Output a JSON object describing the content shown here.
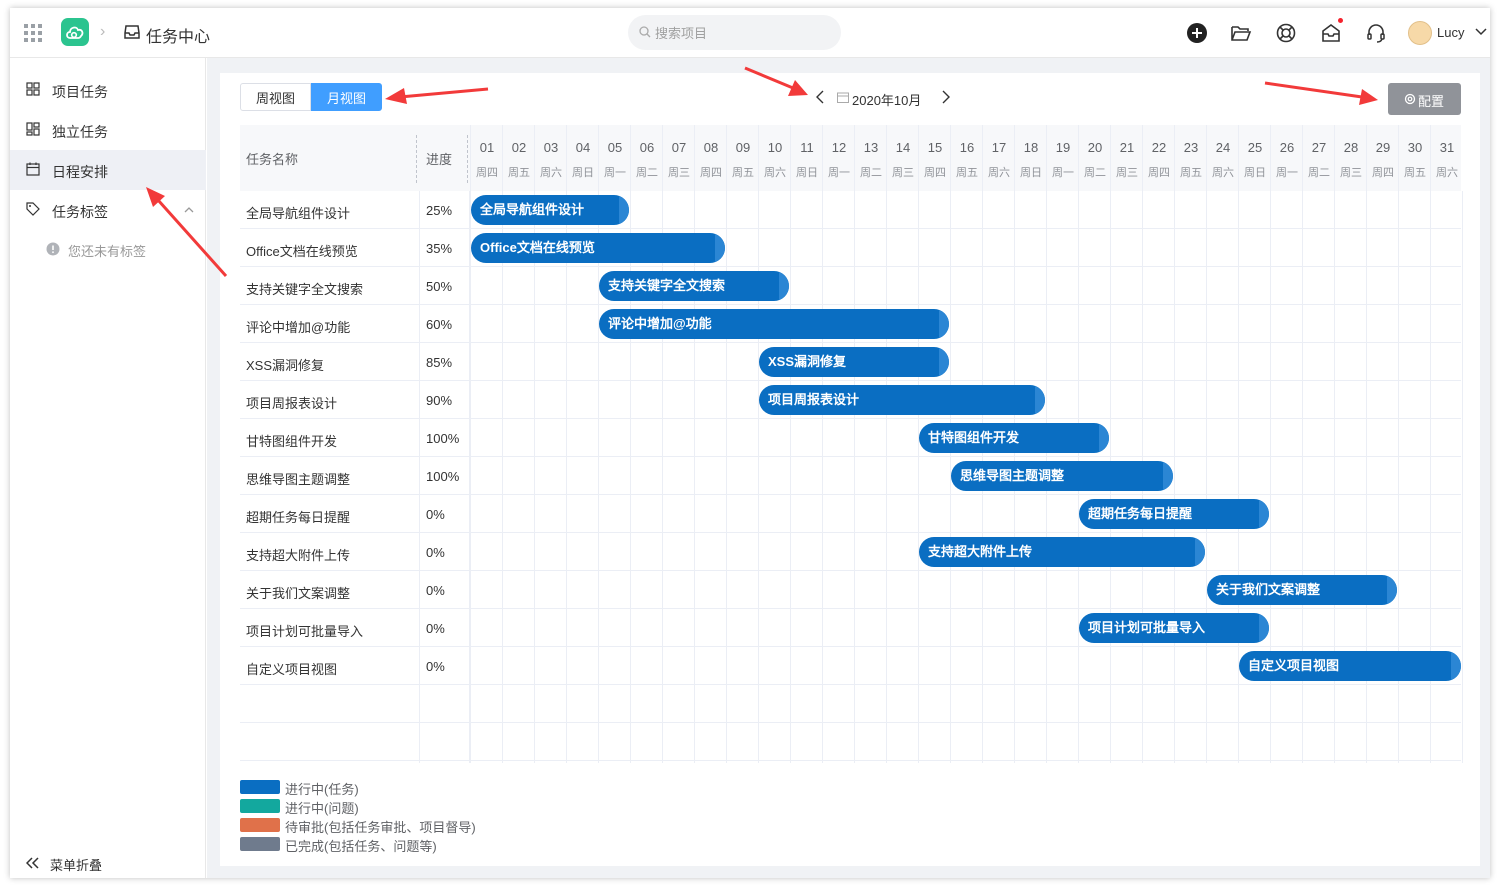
{
  "header": {
    "app_title": "任务中心",
    "search_placeholder": "搜索项目",
    "user_name": "Lucy"
  },
  "sidebar": {
    "items": [
      {
        "label": "项目任务",
        "icon": "grid-icon"
      },
      {
        "label": "独立任务",
        "icon": "layout-icon"
      },
      {
        "label": "日程安排",
        "icon": "calendar-icon",
        "active": true
      },
      {
        "label": "任务标签",
        "icon": "tag-icon"
      }
    ],
    "empty_tags": "您还未有标签",
    "collapse_label": "菜单折叠"
  },
  "toolbar": {
    "week_view": "周视图",
    "month_view": "月视图",
    "active_view": "月视图",
    "month_label": "2020年10月",
    "config_label": "配置"
  },
  "gantt": {
    "task_header": "任务名称",
    "progress_header": "进度",
    "days": [
      {
        "d": "01",
        "w": "周四"
      },
      {
        "d": "02",
        "w": "周五"
      },
      {
        "d": "03",
        "w": "周六"
      },
      {
        "d": "04",
        "w": "周日"
      },
      {
        "d": "05",
        "w": "周一"
      },
      {
        "d": "06",
        "w": "周二"
      },
      {
        "d": "07",
        "w": "周三"
      },
      {
        "d": "08",
        "w": "周四"
      },
      {
        "d": "09",
        "w": "周五"
      },
      {
        "d": "10",
        "w": "周六"
      },
      {
        "d": "11",
        "w": "周日"
      },
      {
        "d": "12",
        "w": "周一"
      },
      {
        "d": "13",
        "w": "周二"
      },
      {
        "d": "14",
        "w": "周三"
      },
      {
        "d": "15",
        "w": "周四"
      },
      {
        "d": "16",
        "w": "周五"
      },
      {
        "d": "17",
        "w": "周六"
      },
      {
        "d": "18",
        "w": "周日"
      },
      {
        "d": "19",
        "w": "周一"
      },
      {
        "d": "20",
        "w": "周二"
      },
      {
        "d": "21",
        "w": "周三"
      },
      {
        "d": "22",
        "w": "周四"
      },
      {
        "d": "23",
        "w": "周五"
      },
      {
        "d": "24",
        "w": "周六"
      },
      {
        "d": "25",
        "w": "周日"
      },
      {
        "d": "26",
        "w": "周一"
      },
      {
        "d": "27",
        "w": "周二"
      },
      {
        "d": "28",
        "w": "周三"
      },
      {
        "d": "29",
        "w": "周四"
      },
      {
        "d": "30",
        "w": "周五"
      },
      {
        "d": "31",
        "w": "周六"
      }
    ],
    "tasks": [
      {
        "name": "全局导航组件设计",
        "progress": "25%",
        "start": 1,
        "end": 5
      },
      {
        "name": "Office文档在线预览",
        "progress": "35%",
        "start": 1,
        "end": 8
      },
      {
        "name": "支持关键字全文搜索",
        "progress": "50%",
        "start": 5,
        "end": 10
      },
      {
        "name": "评论中增加@功能",
        "progress": "60%",
        "start": 5,
        "end": 15
      },
      {
        "name": "XSS漏洞修复",
        "progress": "85%",
        "start": 10,
        "end": 15
      },
      {
        "name": "项目周报表设计",
        "progress": "90%",
        "start": 10,
        "end": 18
      },
      {
        "name": "甘特图组件开发",
        "progress": "100%",
        "start": 15,
        "end": 20
      },
      {
        "name": "思维导图主题调整",
        "progress": "100%",
        "start": 16,
        "end": 22
      },
      {
        "name": "超期任务每日提醒",
        "progress": "0%",
        "start": 20,
        "end": 25
      },
      {
        "name": "支持超大附件上传",
        "progress": "0%",
        "start": 15,
        "end": 23
      },
      {
        "name": "关于我们文案调整",
        "progress": "0%",
        "start": 24,
        "end": 29
      },
      {
        "name": "项目计划可批量导入",
        "progress": "0%",
        "start": 20,
        "end": 25
      },
      {
        "name": "自定义项目视图",
        "progress": "0%",
        "start": 25,
        "end": 31
      }
    ]
  },
  "legend": [
    {
      "label": "进行中(任务)",
      "color": "#0a6ec2"
    },
    {
      "label": "进行中(问题)",
      "color": "#13a89e"
    },
    {
      "label": "待审批(包括任务审批、项目督导)",
      "color": "#e0714a"
    },
    {
      "label": "已完成(包括任务、问题等)",
      "color": "#6f7b8d"
    }
  ],
  "colors": {
    "accent": "#409eff",
    "bar": "#0a6ec2",
    "config_button": "#909399",
    "arrow": "#f23a3a"
  }
}
